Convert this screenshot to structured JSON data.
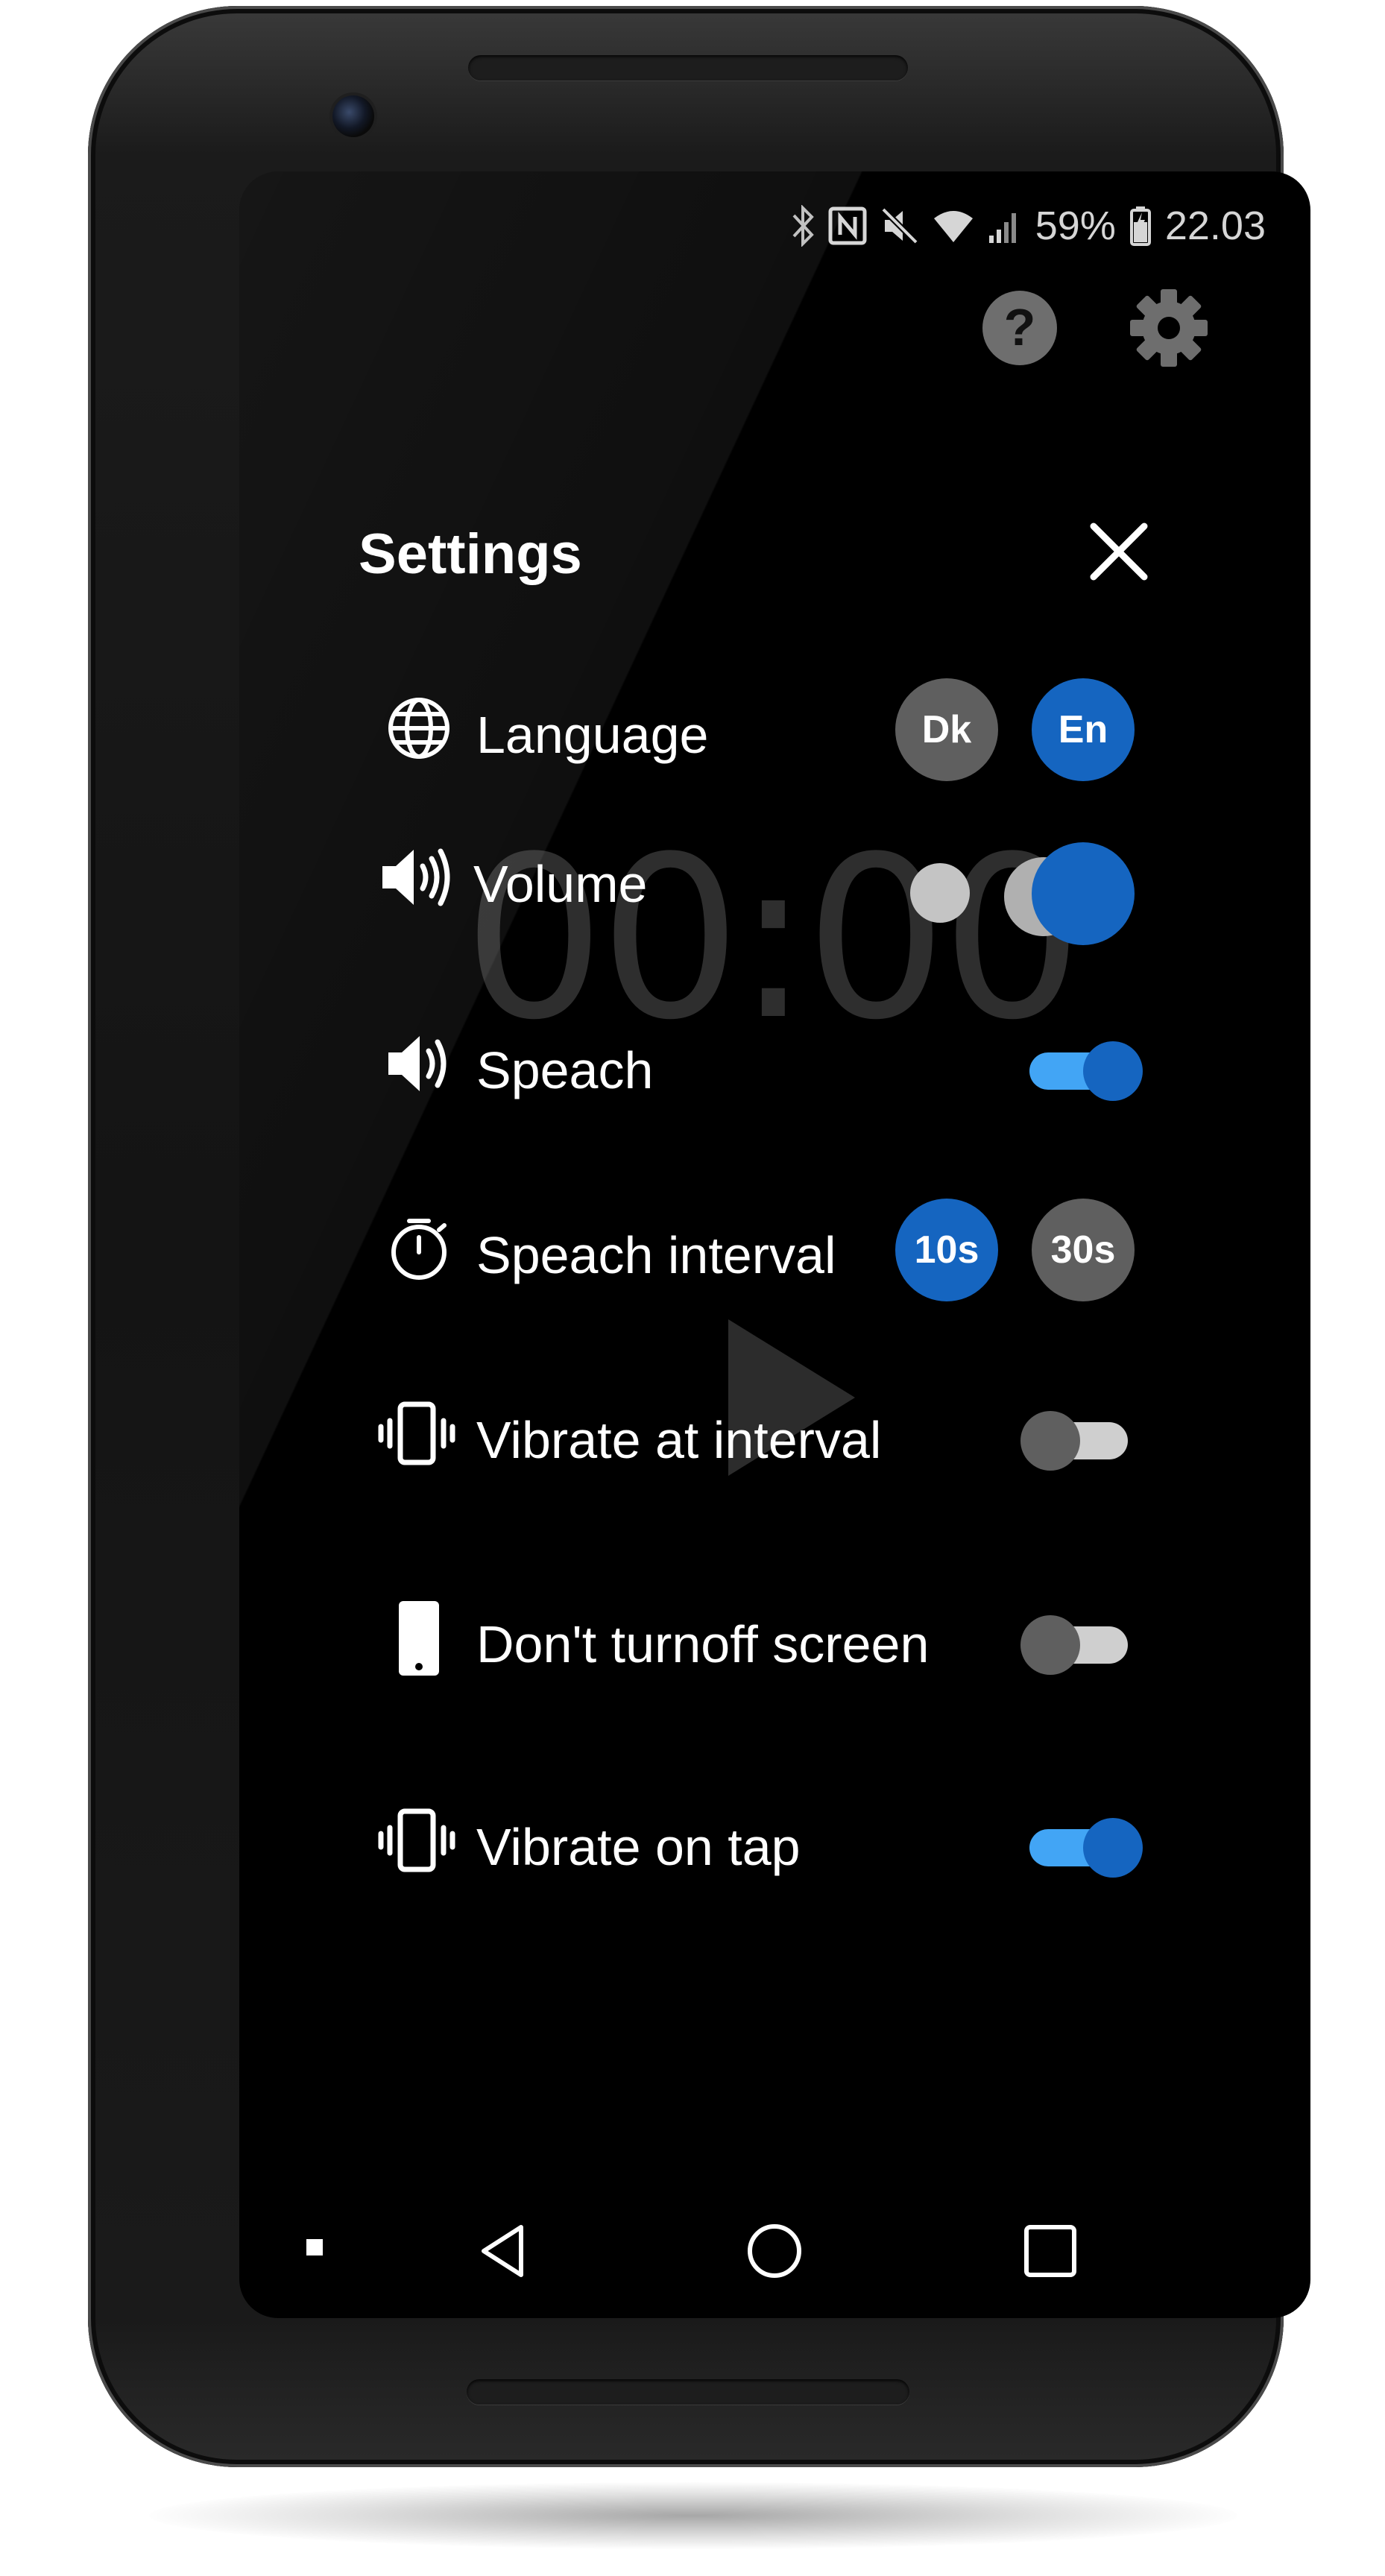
{
  "status_bar": {
    "battery_percent": "59%",
    "time": "22.03",
    "icons": [
      "bluetooth-icon",
      "nfc-icon",
      "mute-icon",
      "wifi-icon",
      "signal-icon",
      "battery-charging-icon"
    ]
  },
  "top_icons": [
    "help-icon",
    "gear-icon"
  ],
  "background": {
    "timer": "00:00",
    "play_icon": "play-icon"
  },
  "settings": {
    "title": "Settings",
    "close_icon": "close-icon",
    "rows": {
      "language": {
        "label": "Language",
        "icon": "globe-icon",
        "options": [
          "Dk",
          "En"
        ],
        "selected": "En"
      },
      "volume": {
        "label": "Volume",
        "icon": "speaker-icon",
        "levels": 3,
        "selected_level": 3
      },
      "speech": {
        "label": "Speach",
        "icon": "speaker-icon",
        "enabled": true
      },
      "speech_interval": {
        "label": "Speach interval",
        "icon": "timer-icon",
        "options": [
          "10s",
          "30s"
        ],
        "selected": "10s"
      },
      "vibrate_interval": {
        "label": "Vibrate at interval",
        "icon": "vibrate-icon",
        "enabled": false
      },
      "keep_screen_on": {
        "label": "Don't turnoff screen",
        "icon": "phone-icon",
        "enabled": false
      },
      "vibrate_tap": {
        "label": "Vibrate on tap",
        "icon": "vibrate-icon",
        "enabled": true
      }
    }
  },
  "colors": {
    "accent_blue": "#1565c0",
    "toggle_track_on": "#42a5f5",
    "chip_gray": "#5f5f5f",
    "background": "#000000"
  },
  "nav_bar": [
    "dot-icon",
    "back-icon",
    "home-icon",
    "recents-icon"
  ]
}
